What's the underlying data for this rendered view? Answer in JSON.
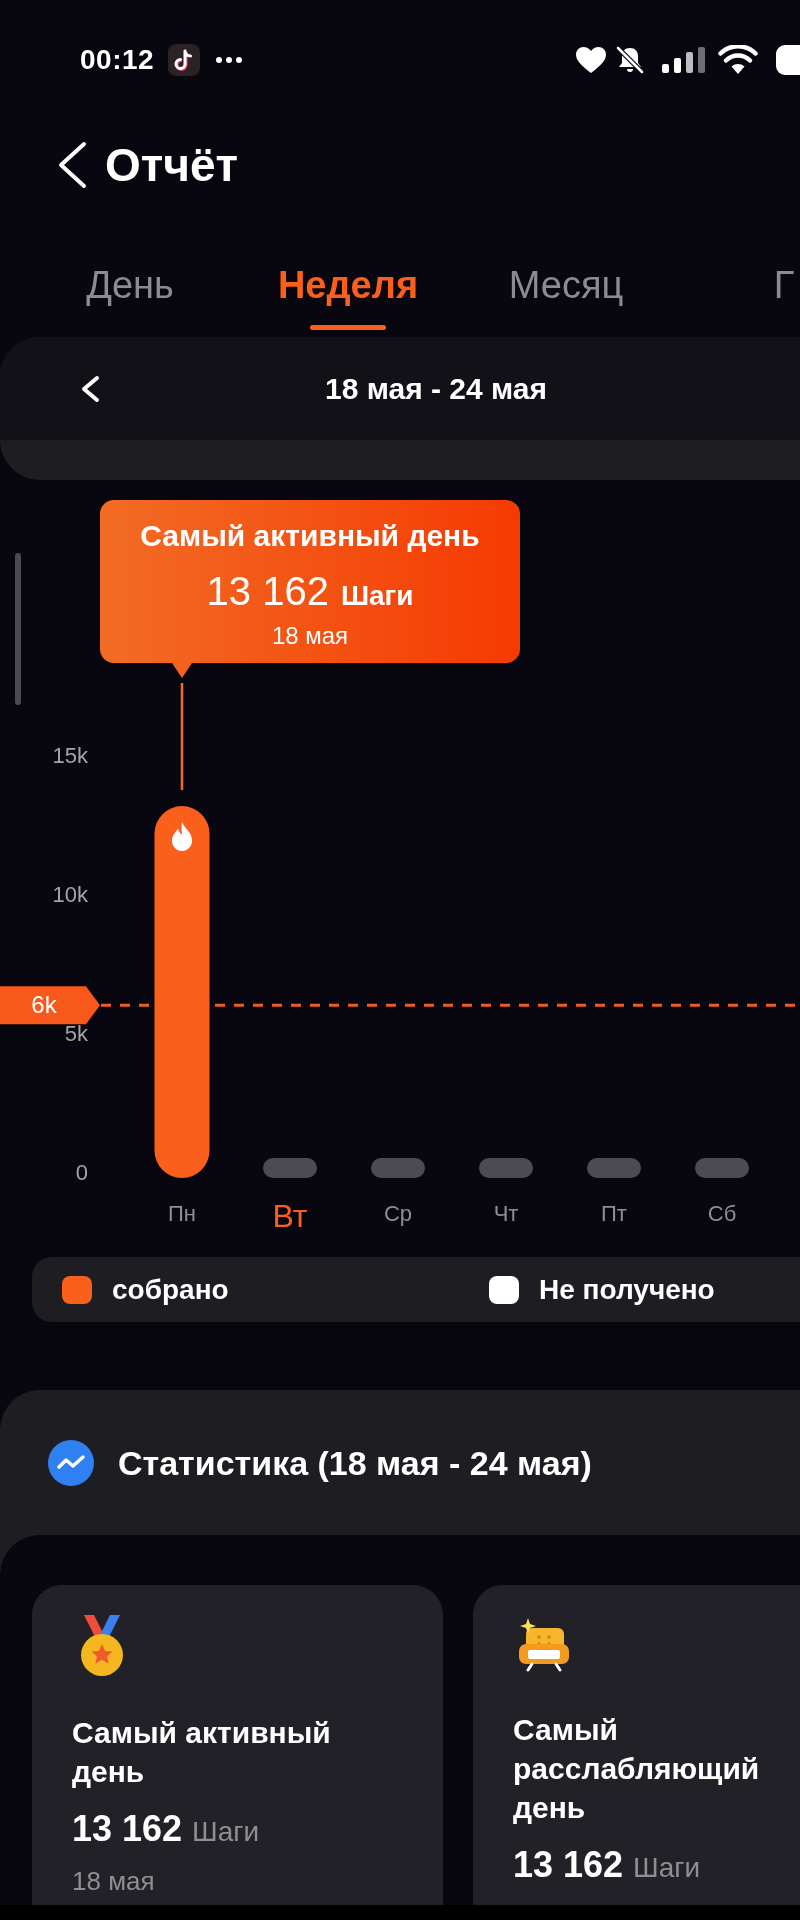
{
  "status_bar": {
    "time": "00:12"
  },
  "header": {
    "title": "Отчёт"
  },
  "tabs": [
    {
      "label": "День",
      "selected": false
    },
    {
      "label": "Неделя",
      "selected": true
    },
    {
      "label": "Месяц",
      "selected": false
    },
    {
      "label": "Г",
      "selected": false
    }
  ],
  "period": {
    "range": "18 мая - 24 мая"
  },
  "chart": {
    "tooltip": {
      "title": "Самый активный день",
      "value": "13 162",
      "unit": "Шаги",
      "date": "18 мая"
    },
    "chart_data": {
      "type": "bar",
      "categories": [
        "Пн",
        "Вт",
        "Ср",
        "Чт",
        "Пт",
        "Сб"
      ],
      "values": [
        13162,
        null,
        null,
        null,
        null,
        null
      ],
      "ylim": [
        0,
        15000
      ],
      "yticks": [
        0,
        {
          "value": 5000,
          "label": "5k"
        },
        {
          "value": 10000,
          "label": "10k"
        },
        {
          "value": 15000,
          "label": "15k"
        }
      ],
      "ref_lines": [
        {
          "axis": "y",
          "value": 6000,
          "label": "6k"
        }
      ]
    },
    "days": [
      {
        "current": false
      },
      {
        "current": true
      },
      {
        "current": false
      },
      {
        "current": false
      },
      {
        "current": false
      },
      {
        "current": false
      }
    ]
  },
  "legend": [
    {
      "label": "собрано",
      "color": "#fa5f1c"
    },
    {
      "label": "Не получено",
      "color": "#ffffff"
    }
  ],
  "statistics": {
    "title": "Статистика (18 мая - 24 мая)",
    "cards": [
      {
        "kind": "medal",
        "title": "Самый активный день",
        "value": "13 162",
        "unit": "Шаги",
        "date": "18 мая"
      },
      {
        "kind": "sofa",
        "title": "Самый расслабляющий день",
        "value": "13 162",
        "unit": "Шаги"
      }
    ]
  }
}
